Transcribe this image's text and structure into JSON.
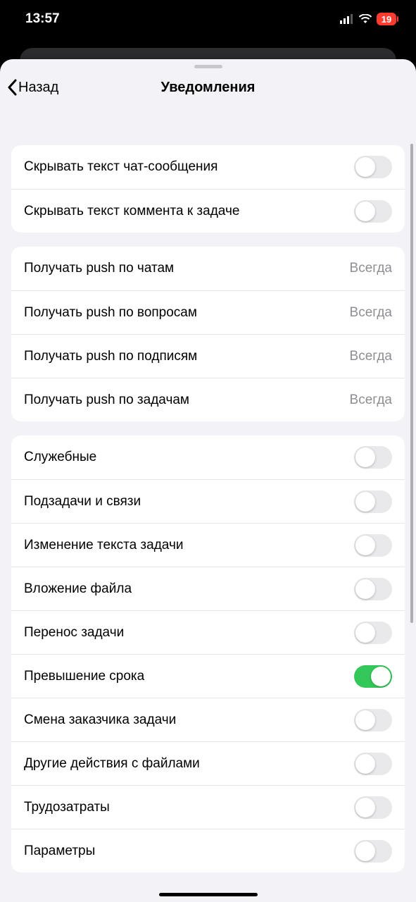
{
  "status": {
    "time": "13:57",
    "battery": "19"
  },
  "nav": {
    "back": "Назад",
    "title": "Уведомления"
  },
  "group1": [
    {
      "label": "Скрывать текст чат-сообщения",
      "on": false
    },
    {
      "label": "Скрывать текст коммента к задаче",
      "on": false
    }
  ],
  "group2": [
    {
      "label": "Получать push по чатам",
      "value": "Всегда"
    },
    {
      "label": "Получать push по вопросам",
      "value": "Всегда"
    },
    {
      "label": "Получать push по подписям",
      "value": "Всегда"
    },
    {
      "label": "Получать push по задачам",
      "value": "Всегда"
    }
  ],
  "group3": [
    {
      "label": "Служебные",
      "on": false
    },
    {
      "label": "Подзадачи и связи",
      "on": false
    },
    {
      "label": "Изменение текста задачи",
      "on": false
    },
    {
      "label": "Вложение файла",
      "on": false
    },
    {
      "label": "Перенос задачи",
      "on": false
    },
    {
      "label": "Превышение срока",
      "on": true
    },
    {
      "label": "Смена заказчика задачи",
      "on": false
    },
    {
      "label": "Другие действия с файлами",
      "on": false
    },
    {
      "label": "Трудозатраты",
      "on": false
    },
    {
      "label": "Параметры",
      "on": false
    }
  ]
}
